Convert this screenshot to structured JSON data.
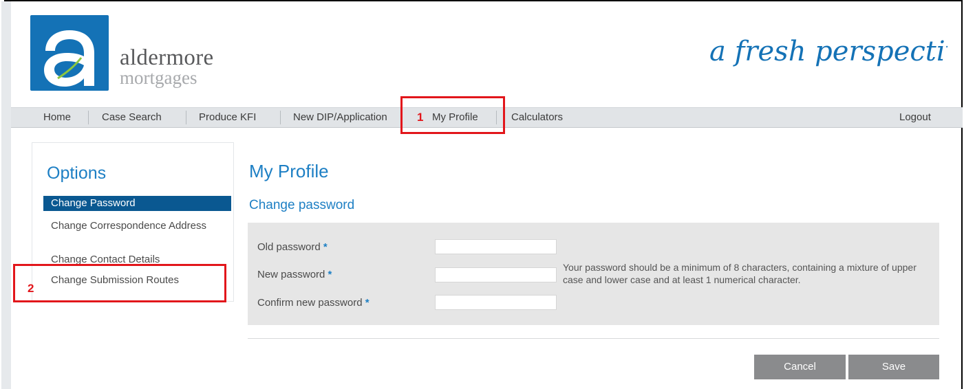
{
  "brand": {
    "logo_letter": "a",
    "name": "aldermore",
    "sub": "mortgages",
    "tagline": "a fresh perspective"
  },
  "nav": {
    "items": [
      "Home",
      "Case Search",
      "Produce KFI",
      "New DIP/Application",
      "My Profile",
      "Calculators"
    ],
    "logout": "Logout"
  },
  "callouts": [
    "1",
    "2"
  ],
  "sidebar": {
    "title": "Options",
    "items": [
      "Change Password",
      "Change Correspondence Address",
      "Change Contact Details",
      "Change Submission Routes"
    ],
    "active_index": 0
  },
  "main": {
    "title": "My Profile",
    "subtitle": "Change password",
    "form": {
      "old_password_label": "Old password",
      "new_password_label": "New password",
      "confirm_password_label": "Confirm new password",
      "required_marker": "*",
      "old_password_value": "",
      "new_password_value": "",
      "confirm_password_value": "",
      "help_text": "Your password should be a minimum of 8 characters, containing a mixture of upper case and lower case and at least 1 numerical character."
    },
    "buttons": {
      "cancel": "Cancel",
      "save": "Save"
    }
  },
  "colors": {
    "brand_blue": "#1472b6",
    "accent_blue": "#1d7fc4",
    "active_bg": "#0a5891",
    "callout_red": "#e2161b",
    "button_gray": "#8a8b8d"
  }
}
